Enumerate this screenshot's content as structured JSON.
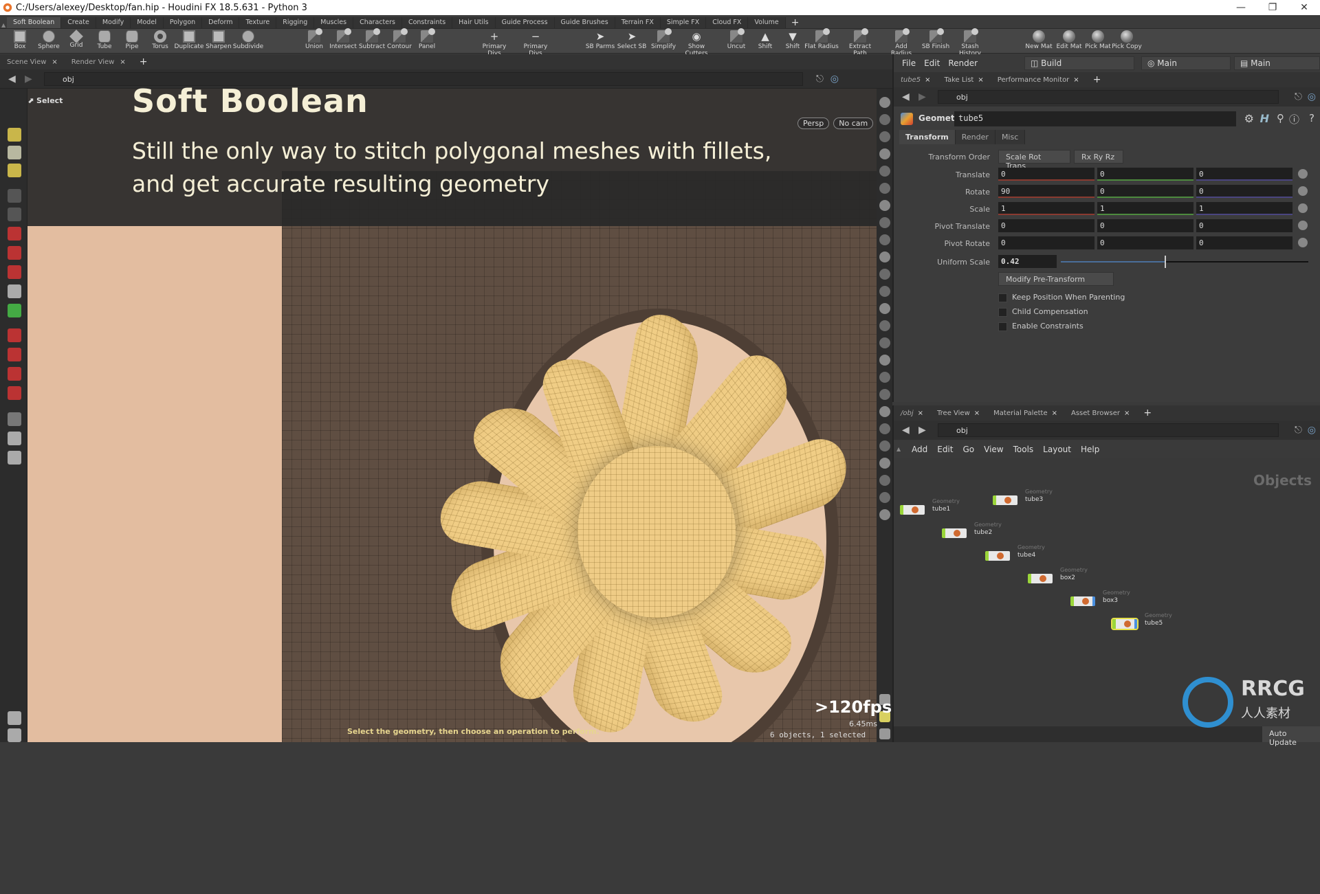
{
  "window": {
    "title": "C:/Users/alexey/Desktop/fan.hip - Houdini FX 18.5.631 - Python 3",
    "controls": [
      "minimize",
      "restore",
      "close"
    ]
  },
  "shelf": {
    "tabs": [
      "Soft Boolean",
      "Create",
      "Modify",
      "Model",
      "Polygon",
      "Deform",
      "Texture",
      "Rigging",
      "Muscles",
      "Characters",
      "Constraints",
      "Hair Utils",
      "Guide Process",
      "Guide Brushes",
      "Terrain FX",
      "Simple FX",
      "Cloud FX",
      "Volume"
    ],
    "active_tab": "Soft Boolean",
    "add_tab_label": "+",
    "tools": [
      {
        "label": "Box",
        "icon": "box-icon"
      },
      {
        "label": "Sphere",
        "icon": "sphere-icon"
      },
      {
        "label": "Grid",
        "icon": "grid-icon"
      },
      {
        "label": "Tube",
        "icon": "tube-icon"
      },
      {
        "label": "Pipe",
        "icon": "pipe-icon"
      },
      {
        "label": "Torus",
        "icon": "torus-icon"
      },
      {
        "label": "Duplicate",
        "icon": "duplicate-icon"
      },
      {
        "label": "Sharpen",
        "icon": "sharpen-icon"
      },
      {
        "label": "Subdivide",
        "icon": "subdivide-icon"
      },
      {
        "label": "Union",
        "icon": "boolean-icon"
      },
      {
        "label": "Intersect",
        "icon": "boolean-icon"
      },
      {
        "label": "Subtract",
        "icon": "boolean-icon"
      },
      {
        "label": "Contour",
        "icon": "boolean-icon"
      },
      {
        "label": "Panel",
        "icon": "boolean-icon"
      },
      {
        "label": "Primary Divs",
        "icon": "plus-icon"
      },
      {
        "label": "Primary Divs",
        "icon": "minus-icon"
      },
      {
        "label": "SB Parms",
        "icon": "cursor-icon"
      },
      {
        "label": "Select SB",
        "icon": "cursor-icon"
      },
      {
        "label": "Simplify",
        "icon": "boolean-icon"
      },
      {
        "label": "Show Cutters",
        "icon": "eye-icon"
      },
      {
        "label": "Uncut",
        "icon": "boolean-icon"
      },
      {
        "label": "Shift",
        "icon": "triangle-up-icon"
      },
      {
        "label": "Shift",
        "icon": "triangle-down-icon"
      },
      {
        "label": "Flat Radius",
        "icon": "boolean-icon"
      },
      {
        "label": "Extract Path",
        "icon": "boolean-icon"
      },
      {
        "label": "Add Radius",
        "icon": "boolean-icon"
      },
      {
        "label": "SB Finish",
        "icon": "boolean-icon"
      },
      {
        "label": "Stash History",
        "icon": "boolean-icon"
      },
      {
        "label": "New Mat",
        "icon": "material-icon"
      },
      {
        "label": "Edit Mat",
        "icon": "material-icon"
      },
      {
        "label": "Pick Mat",
        "icon": "material-icon"
      },
      {
        "label": "Pick Copy",
        "icon": "material-icon"
      }
    ]
  },
  "viewport_pane": {
    "tabs": [
      "Scene View",
      "Render View"
    ],
    "path": "obj",
    "select_label": "Select",
    "camera_buttons": [
      "Persp",
      "No cam"
    ],
    "fps": ">120fps",
    "frame_time": "6.45ms",
    "object_count": "6 objects, 1 selected",
    "status_message": "Select the geometry, then choose an operation to perform.",
    "overlay": {
      "title": "Soft Boolean",
      "subtitle_line1": "Still the only way to stitch polygonal meshes with fillets,",
      "subtitle_line2": "and get accurate resulting geometry"
    }
  },
  "right_pane": {
    "menu": [
      "File",
      "Edit",
      "Render"
    ],
    "desktop": "Build",
    "takes": "Main",
    "main_label": "Main",
    "tabs": [
      "tube5",
      "Take List",
      "Performance Monitor"
    ],
    "path": "obj",
    "node_type": "Geometry",
    "node_name": "tube5",
    "param_tabs": [
      "Transform",
      "Render",
      "Misc"
    ],
    "active_param_tab": "Transform",
    "transform_order_label": "Transform Order",
    "transform_order": "Scale Rot Trans",
    "rotate_order": "Rx Ry Rz",
    "params": [
      {
        "label": "Translate",
        "values": [
          "0",
          "0",
          "0"
        ]
      },
      {
        "label": "Rotate",
        "values": [
          "90",
          "0",
          "0"
        ]
      },
      {
        "label": "Scale",
        "values": [
          "1",
          "1",
          "1"
        ]
      },
      {
        "label": "Pivot Translate",
        "values": [
          "0",
          "0",
          "0"
        ]
      },
      {
        "label": "Pivot Rotate",
        "values": [
          "0",
          "0",
          "0"
        ]
      }
    ],
    "uniform_scale_label": "Uniform Scale",
    "uniform_scale": "0.42",
    "modify_pretransform": "Modify Pre-Transform",
    "checkboxes": [
      {
        "label": "Keep Position When Parenting",
        "checked": false
      },
      {
        "label": "Child Compensation",
        "checked": false
      },
      {
        "label": "Enable Constraints",
        "checked": false
      }
    ]
  },
  "network_pane": {
    "tabs": [
      "/obj",
      "Tree View",
      "Material Palette",
      "Asset Browser"
    ],
    "path": "obj",
    "menu": [
      "Add",
      "Edit",
      "Go",
      "View",
      "Tools",
      "Layout",
      "Help"
    ],
    "context_label": "Objects",
    "nodes": [
      {
        "type": "Geometry",
        "name": "tube1",
        "selected": false,
        "display": false
      },
      {
        "type": "Geometry",
        "name": "tube3",
        "selected": false,
        "display": false
      },
      {
        "type": "Geometry",
        "name": "tube2",
        "selected": false,
        "display": false
      },
      {
        "type": "Geometry",
        "name": "tube4",
        "selected": false,
        "display": false
      },
      {
        "type": "Geometry",
        "name": "box2",
        "selected": false,
        "display": false
      },
      {
        "type": "Geometry",
        "name": "box3",
        "selected": false,
        "display": true
      },
      {
        "type": "Geometry",
        "name": "tube5",
        "selected": true,
        "display": true
      }
    ],
    "auto_update": "Auto Update"
  },
  "watermark": {
    "logo_text": "RRCG",
    "logo_sub": "人人素材"
  }
}
